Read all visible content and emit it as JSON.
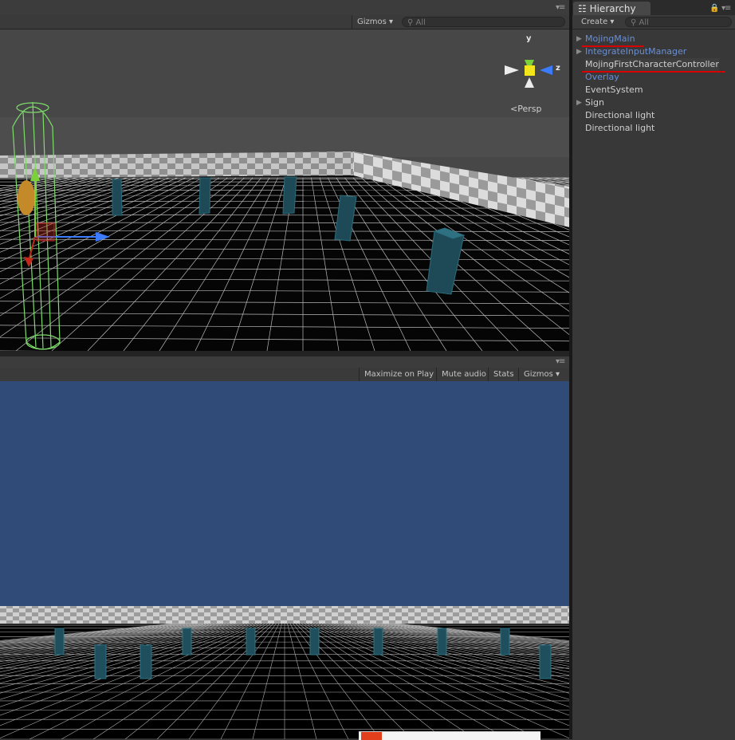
{
  "scene": {
    "gizmos_label": "Gizmos",
    "search_placeholder": "All",
    "persp_label": "Persp",
    "axes": {
      "y": "y",
      "z": "z"
    }
  },
  "game": {
    "maximize_label": "Maximize on Play",
    "mute_label": "Mute audio",
    "stats_label": "Stats",
    "gizmos_label": "Gizmos"
  },
  "hierarchy": {
    "tab_title": "Hierarchy",
    "create_label": "Create",
    "search_placeholder": "All",
    "items": [
      {
        "label": "MojingMain",
        "prefab": true,
        "expandable": true
      },
      {
        "label": "IntegrateInputManager",
        "prefab": true,
        "expandable": true
      },
      {
        "label": "MojingFirstCharacterController",
        "prefab": false,
        "expandable": false,
        "selected": true
      },
      {
        "label": "Overlay",
        "prefab": true,
        "expandable": false
      },
      {
        "label": "EventSystem",
        "prefab": false,
        "expandable": false
      },
      {
        "label": "Sign",
        "prefab": false,
        "expandable": true
      },
      {
        "label": "Directional light",
        "prefab": false,
        "expandable": false
      },
      {
        "label": "Directional light",
        "prefab": false,
        "expandable": false
      }
    ]
  },
  "colors": {
    "sky": "#304b78",
    "pillar": "#1f4e5c",
    "prefab_text": "#6a8fd6",
    "annotation_red": "#d60000",
    "collider_green": "#7ddc6a"
  }
}
